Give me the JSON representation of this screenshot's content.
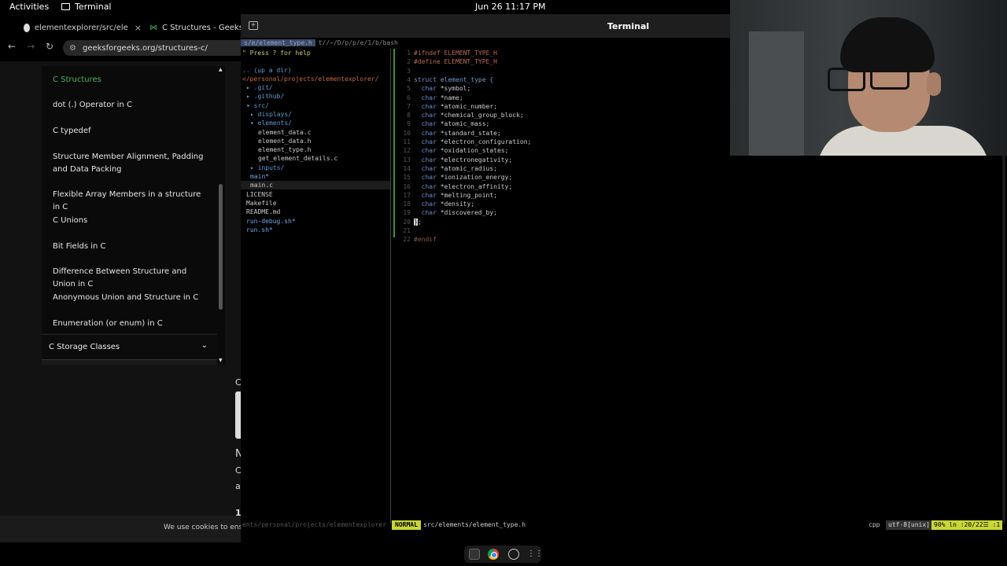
{
  "topbar": {
    "activities": "Activities",
    "app_name": "Terminal",
    "clock": "Jun 26  11:17 PM"
  },
  "browser": {
    "tabs": [
      {
        "label": "elementexplorer/src/ele",
        "close": "×"
      },
      {
        "label": "C Structures - Geeksfo"
      }
    ],
    "url": "geeksforgeeks.org/structures-c/",
    "sidebar_items": [
      "C Structures",
      "dot (.) Operator in C",
      "C typedef",
      "Structure Member Alignment, Padding and Data Packing",
      "Flexible Array Members in a structure in C",
      "C Unions",
      "Bit Fields in C",
      "Difference Between Structure and Union in C",
      "Anonymous Union and Structure in C",
      "Enumeration (or enum) in C"
    ],
    "storage_section": "C Storage Classes",
    "peek_chars": [
      "C",
      "N",
      "C",
      "a",
      "1"
    ],
    "cookie_text": "We use cookies to ensure"
  },
  "terminal": {
    "title": "Terminal",
    "tabline_selected": "s/e/element_type.h",
    "tabline_rest": "t//~/D/p/p/e/1/b/bash",
    "nerdtree": {
      "hint": "\" Press ? for help",
      "up": ".. (up a dir)",
      "root": "</personal/projects/elementexplorer/",
      "entries": [
        {
          "text": "▸ .git/",
          "kind": "dir",
          "indent": 1
        },
        {
          "text": "▸ .github/",
          "kind": "dir",
          "indent": 1
        },
        {
          "text": "▾ src/",
          "kind": "dir",
          "indent": 1
        },
        {
          "text": "▸ displays/",
          "kind": "dir",
          "indent": 2
        },
        {
          "text": "▾ elements/",
          "kind": "dir",
          "indent": 2
        },
        {
          "text": "element_data.c",
          "kind": "file",
          "indent": 4
        },
        {
          "text": "element_data.h",
          "kind": "file",
          "indent": 4
        },
        {
          "text": "element_type.h",
          "kind": "file",
          "indent": 4
        },
        {
          "text": "get_element_details.c",
          "kind": "file",
          "indent": 4
        },
        {
          "text": "▸ inputs/",
          "kind": "dir",
          "indent": 2
        },
        {
          "text": "main*",
          "kind": "exec",
          "indent": 2
        },
        {
          "text": "main.c",
          "kind": "file",
          "indent": 2
        },
        {
          "text": "LICENSE",
          "kind": "file",
          "indent": 1
        },
        {
          "text": "Makefile",
          "kind": "file",
          "indent": 1
        },
        {
          "text": "README.md",
          "kind": "file",
          "indent": 1
        },
        {
          "text": "run-debug.sh*",
          "kind": "exec",
          "indent": 1
        },
        {
          "text": "run.sh*",
          "kind": "exec",
          "indent": 1
        }
      ]
    },
    "code_lines": [
      {
        "n": "1",
        "text": "#ifndef ELEMENT_TYPE_H",
        "cls": "c-pre"
      },
      {
        "n": "2",
        "text": "#define ELEMENT_TYPE_H",
        "cls": "c-pre"
      },
      {
        "n": "3",
        "text": "",
        "cls": "c-id"
      },
      {
        "n": "4",
        "text": "struct element_type {",
        "cls": "c-kw"
      },
      {
        "n": "5",
        "text": "  char *symbol;",
        "cls": "c-type"
      },
      {
        "n": "6",
        "text": "  char *name;",
        "cls": "c-type"
      },
      {
        "n": "7",
        "text": "  char *atomic_number;",
        "cls": "c-type"
      },
      {
        "n": "8",
        "text": "  char *chemical_group_block;",
        "cls": "c-type"
      },
      {
        "n": "9",
        "text": "  char *atomic_mass;",
        "cls": "c-type"
      },
      {
        "n": "10",
        "text": "  char *standard_state;",
        "cls": "c-type"
      },
      {
        "n": "11",
        "text": "  char *electron_configuration;",
        "cls": "c-type"
      },
      {
        "n": "12",
        "text": "  char *oxidation_states;",
        "cls": "c-type"
      },
      {
        "n": "13",
        "text": "  char *electronegativity;",
        "cls": "c-type"
      },
      {
        "n": "14",
        "text": "  char *atomic_radius;",
        "cls": "c-type"
      },
      {
        "n": "15",
        "text": "  char *ionization_energy;",
        "cls": "c-type"
      },
      {
        "n": "16",
        "text": "  char *electron_affinity;",
        "cls": "c-type"
      },
      {
        "n": "17",
        "text": "  char *melting_point;",
        "cls": "c-type"
      },
      {
        "n": "18",
        "text": "  char *density;",
        "cls": "c-type"
      },
      {
        "n": "19",
        "text": "  char *discovered_by;",
        "cls": "c-type"
      },
      {
        "n": "20",
        "text": "};",
        "cls": "c-id"
      },
      {
        "n": "21",
        "text": "",
        "cls": "c-id"
      },
      {
        "n": "22",
        "text": "#endif",
        "cls": "c-end"
      }
    ],
    "status": {
      "left_path": "ents/personal/projects/elementexplorer",
      "mode": "NORMAL",
      "file": "src/elements/element_type.h",
      "filetype": "cpp",
      "encoding": "utf-8[unix]",
      "position": "90% ln :20/22☰ :1"
    }
  },
  "colors": {
    "accent_green": "#46b35f",
    "vim_mode_bg": "#c9d637"
  }
}
